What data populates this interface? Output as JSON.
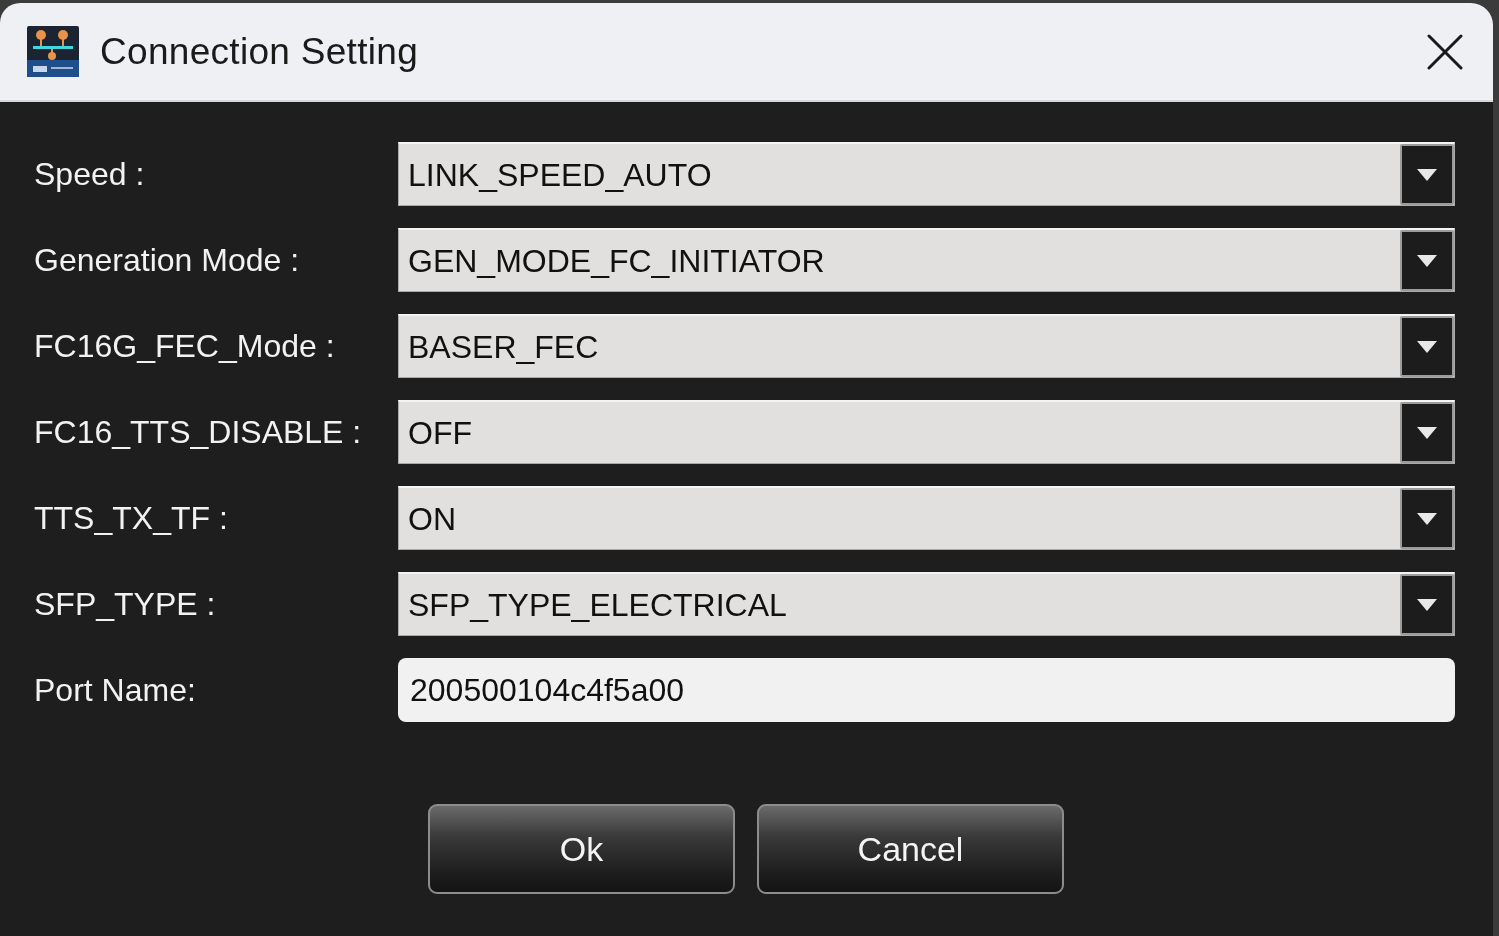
{
  "window": {
    "title": "Connection Setting"
  },
  "fields": [
    {
      "kind": "combo",
      "label": "Speed :",
      "value": "LINK_SPEED_AUTO"
    },
    {
      "kind": "combo",
      "label": "Generation Mode :",
      "value": "GEN_MODE_FC_INITIATOR"
    },
    {
      "kind": "combo",
      "label": "FC16G_FEC_Mode :",
      "value": "BASER_FEC"
    },
    {
      "kind": "combo",
      "label": "FC16_TTS_DISABLE :",
      "value": "OFF"
    },
    {
      "kind": "combo",
      "label": "TTS_TX_TF :",
      "value": "ON"
    },
    {
      "kind": "combo",
      "label": "SFP_TYPE :",
      "value": "SFP_TYPE_ELECTRICAL"
    },
    {
      "kind": "text",
      "label": "Port Name:",
      "value": "200500104c4f5a00"
    }
  ],
  "buttons": [
    "Ok",
    "Cancel"
  ]
}
